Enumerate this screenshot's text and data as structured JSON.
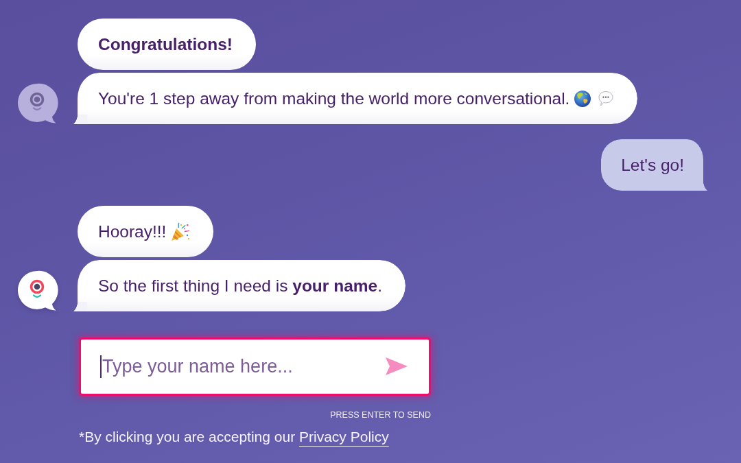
{
  "conversation": {
    "groups": [
      {
        "outgoing": false,
        "avatar_active": false,
        "messages": [
          {
            "kind": "title",
            "text": "Congratulations!"
          },
          {
            "kind": "text",
            "text": "You're 1 step away from making the world more conversational.",
            "icons": [
              {
                "kind": "globe"
              },
              {
                "kind": "speech_balloon"
              }
            ]
          }
        ]
      },
      {
        "outgoing": true,
        "messages": [
          {
            "kind": "text",
            "text": "Let's go!"
          }
        ]
      },
      {
        "outgoing": false,
        "avatar_active": true,
        "messages": [
          {
            "kind": "text",
            "text": "Hooray!!!",
            "icons": [
              {
                "kind": "party_popper"
              }
            ]
          },
          {
            "kind": "text",
            "text": "So the first thing I need is **your name**."
          }
        ]
      }
    ]
  },
  "composer": {
    "placeholder": "Type your name here...",
    "focused": true,
    "hint": "PRESS ENTER TO SEND"
  },
  "footer": {
    "text": "*By clicking you are accepting our",
    "link": "Privacy Policy"
  }
}
